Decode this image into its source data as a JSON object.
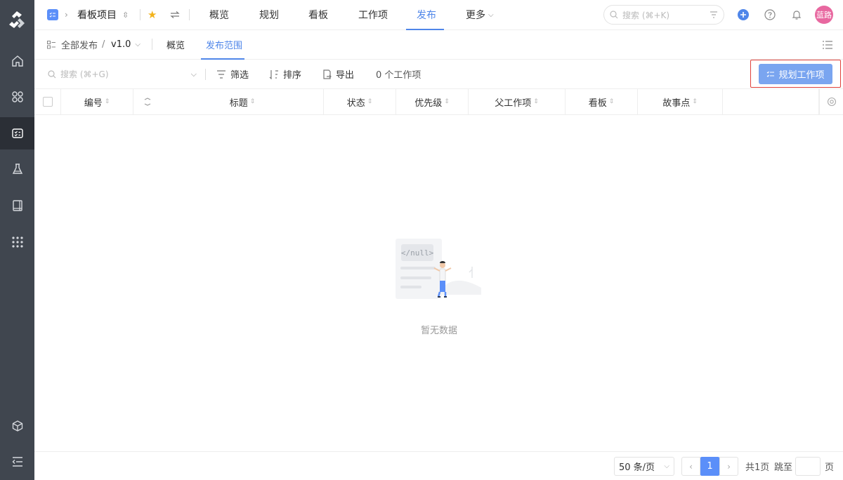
{
  "header": {
    "project_name": "看板项目",
    "tabs": [
      {
        "label": "概览"
      },
      {
        "label": "规划"
      },
      {
        "label": "看板"
      },
      {
        "label": "工作项"
      },
      {
        "label": "发布",
        "active": true
      },
      {
        "label": "更多"
      }
    ],
    "search_placeholder": "搜索 (⌘+K)",
    "avatar_text": "蓝路"
  },
  "subheader": {
    "breadcrumb_root": "全部发布",
    "breadcrumb_sep": "/",
    "version": "v1.0",
    "tabs": [
      {
        "label": "概览"
      },
      {
        "label": "发布范围",
        "active": true
      }
    ]
  },
  "toolbar": {
    "search_placeholder": "搜索 (⌘+G)",
    "filter_label": "筛选",
    "sort_label": "排序",
    "export_label": "导出",
    "count_text": "0 个工作项",
    "plan_button_label": "规划工作项"
  },
  "table": {
    "columns": [
      "编号",
      "标题",
      "状态",
      "优先级",
      "父工作项",
      "看板",
      "故事点"
    ]
  },
  "empty": {
    "code_label": "</null>",
    "text": "暂无数据"
  },
  "pagination": {
    "page_size": "50 条/页",
    "current_page": "1",
    "total_text": "共1页",
    "jump_label": "跳至",
    "page_unit": "页"
  },
  "colors": {
    "accent": "#4f86e9",
    "sidebar_bg": "#40464f",
    "highlight": "#e0403a"
  }
}
